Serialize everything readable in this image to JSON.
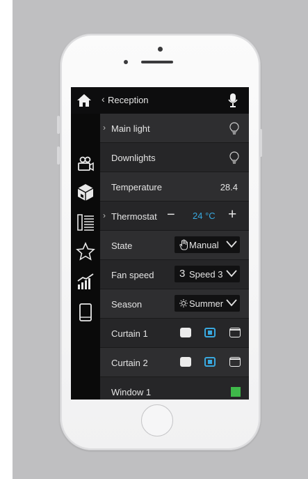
{
  "header": {
    "title": "Reception"
  },
  "rows": {
    "main_light": {
      "label": "Main light"
    },
    "downlights": {
      "label": "Downlights"
    },
    "temperature": {
      "label": "Temperature",
      "value": "28.4"
    },
    "thermostat": {
      "label": "Thermostat",
      "minus": "−",
      "value": "24 °C",
      "plus": "+"
    },
    "state": {
      "label": "State",
      "value": "Manual",
      "icon": "hand-icon"
    },
    "fan_speed": {
      "label": "Fan speed",
      "value": "Speed 3",
      "prefix": "3"
    },
    "season": {
      "label": "Season",
      "value": "Summer",
      "icon": "sun-icon"
    },
    "curtain1": {
      "label": "Curtain 1",
      "selected": "stop"
    },
    "curtain2": {
      "label": "Curtain 2",
      "selected": "stop"
    },
    "window1": {
      "label": "Window 1",
      "status": "open"
    }
  },
  "sidebar": {
    "items": [
      "home-icon",
      "camera-icon",
      "cube-icon",
      "list-icon",
      "star-icon",
      "chart-icon",
      "tablet-icon"
    ]
  },
  "colors": {
    "accent": "#39a9e0",
    "status_green": "#3fb94a",
    "screen_bg": "#1f1f20"
  }
}
